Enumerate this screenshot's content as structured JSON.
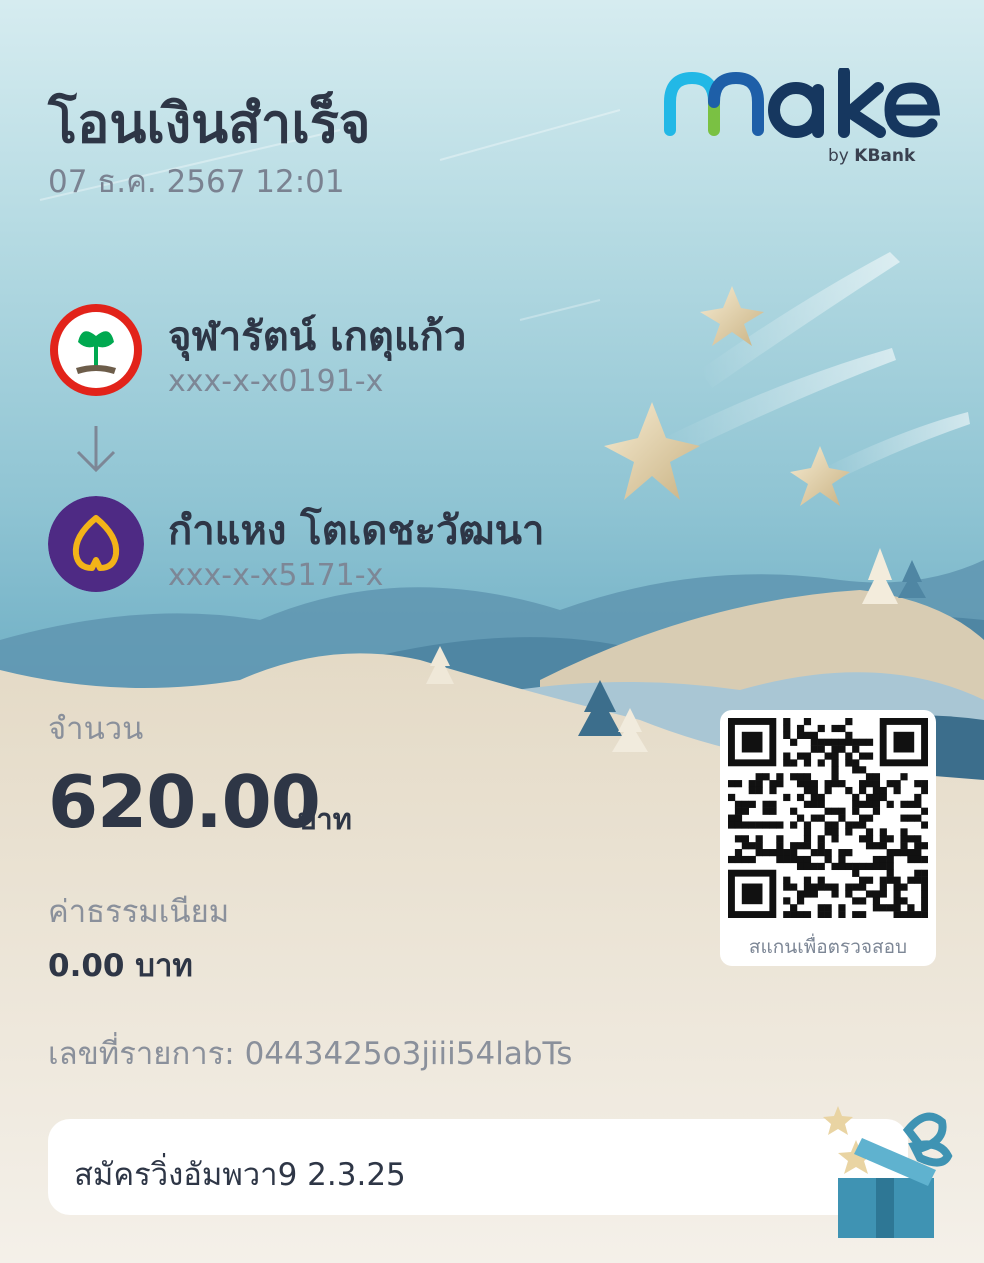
{
  "header": {
    "title": "โอนเงินสำเร็จ",
    "datetime": "07 ธ.ค. 2567 12:01"
  },
  "brand": {
    "logo_text": "make",
    "by_text": "by",
    "bank_text": "KBank",
    "colors": {
      "blue": "#1e5fa8",
      "cyan": "#22b8e6",
      "green": "#7ac143",
      "navy": "#16375f"
    }
  },
  "sender": {
    "bank_icon": "kbank-logo-icon",
    "name": "จุฬารัตน์ เกตุแก้ว",
    "account": "xxx-x-x0191-x"
  },
  "receiver": {
    "bank_icon": "scb-logo-icon",
    "name": "กำแหง โตเดชะวัฒนา",
    "account": "xxx-x-x5171-x"
  },
  "amount": {
    "label": "จำนวน",
    "value": "620.00",
    "unit": "บาท"
  },
  "fee": {
    "label": "ค่าธรรมเนียม",
    "value": "0.00 บาท"
  },
  "reference": {
    "text": "เลขที่รายการ: 0443425o3jiii54labTs"
  },
  "qr": {
    "caption": "สแกนเพื่อตรวจสอบ"
  },
  "memo": {
    "text": "สมัครวิ่งอัมพวา9 2.3.25"
  }
}
